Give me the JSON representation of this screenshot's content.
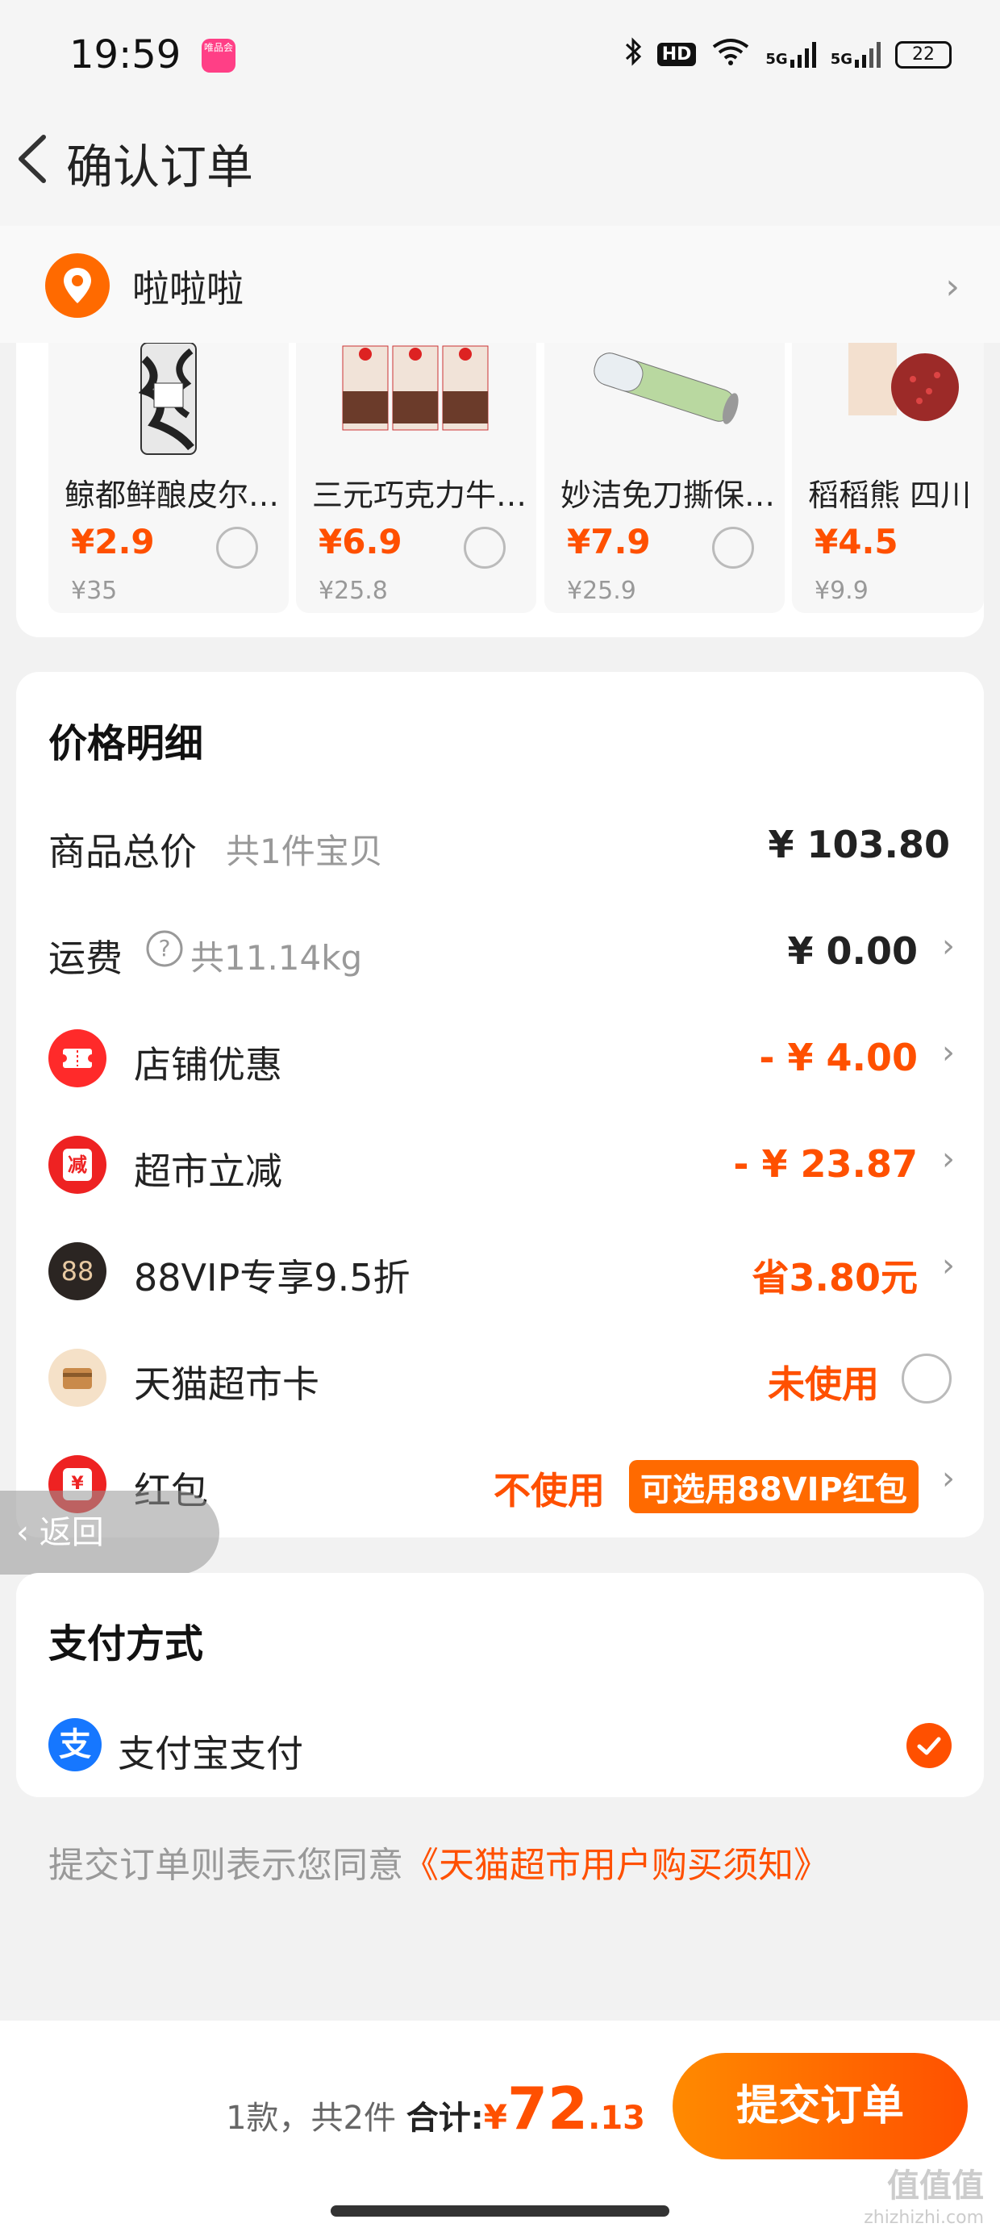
{
  "status_bar": {
    "time": "19:59",
    "app_badge": "唯品会",
    "hd": "HD",
    "signal1": "5G",
    "signal2": "5G",
    "battery": "22"
  },
  "header": {
    "title": "确认订单"
  },
  "address": {
    "name": "啦啦啦"
  },
  "products": [
    {
      "name": "鲸都鲜酿皮尔…",
      "price": "¥2.9",
      "orig": "¥35"
    },
    {
      "name": "三元巧克力牛…",
      "price": "¥6.9",
      "orig": "¥25.8"
    },
    {
      "name": "妙洁免刀撕保…",
      "price": "¥7.9",
      "orig": "¥25.9"
    },
    {
      "name": "稻稻熊 四川",
      "price": "¥4.5",
      "orig": "¥9.9"
    }
  ],
  "price_detail": {
    "title": "价格明细",
    "total": {
      "label": "商品总价",
      "sub": "共1件宝贝",
      "value": "¥ 103.80"
    },
    "shipping": {
      "label": "运费",
      "sub": "共11.14kg",
      "value": "¥ 0.00"
    },
    "shop_discount": {
      "label": "店铺优惠",
      "value": "- ¥ 4.00"
    },
    "market_discount": {
      "label": "超市立减",
      "value": "- ¥ 23.87",
      "icon_char": "减"
    },
    "vip": {
      "label": "88VIP专享9.5折",
      "value": "省3.80元",
      "icon_char": "88"
    },
    "card": {
      "label": "天猫超市卡",
      "value": "未使用"
    },
    "redpacket": {
      "label": "红包",
      "value": "不使用",
      "chip": "可选用88VIP红包",
      "icon_char": "¥"
    }
  },
  "return_float": {
    "label": "返回"
  },
  "payment": {
    "title": "支付方式",
    "method": "支付宝支付",
    "icon_char": "支"
  },
  "agreement": {
    "prefix": "提交订单则表示您同意",
    "link": "《天猫超市用户购买须知》"
  },
  "bottom": {
    "count": "1款，共2件",
    "total_label": "合计:",
    "currency": "¥",
    "total_int": "72",
    "total_dec": ".13",
    "submit": "提交订单"
  },
  "watermark": {
    "main": "值值值",
    "sub": "zhizhizhi.com"
  },
  "colors": {
    "accent": "#ff5000",
    "background": "#f2f2f2",
    "alipay_blue": "#1677ff"
  }
}
